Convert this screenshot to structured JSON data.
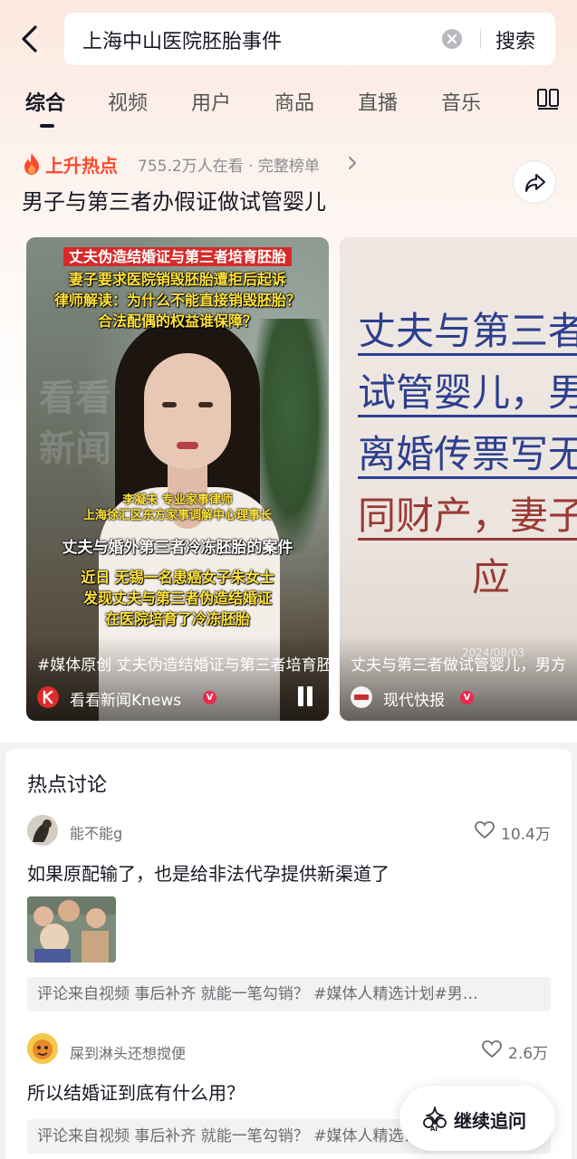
{
  "search": {
    "query": "上海中山医院胚胎事件",
    "button_label": "搜索"
  },
  "tabs": [
    {
      "label": "综合"
    },
    {
      "label": "视频"
    },
    {
      "label": "用户"
    },
    {
      "label": "商品"
    },
    {
      "label": "直播"
    },
    {
      "label": "音乐"
    }
  ],
  "hot": {
    "badge": "上升热点",
    "count_text": "755.2万人在看 · 完整榜单",
    "headline": "男子与第三者办假证做试管婴儿"
  },
  "video_cards": [
    {
      "captions": {
        "red_title": "丈夫伪造结婚证与第三者培育胚胎",
        "line1": "妻子要求医院销毁胚胎遭拒后起诉",
        "line2": "律师解读：为什么不能直接销毁胚胎？",
        "line3": "合法配偶的权益谁保障？",
        "lawyer_name": "李凝未  专业家事律师",
        "lawyer_title": "上海徐汇区东方家事调解中心理事长",
        "case_title": "丈夫与婚外第三者冷冻胚胎的案件",
        "story1": "近日  无锡一名患癌女子朱女士",
        "story2": "发现丈夫与第三者伪造结婚证",
        "story3": "在医院培育了冷冻胚胎"
      },
      "watermark": [
        "看看",
        "新闻"
      ],
      "description": "#媒体原创 丈夫伪造结婚证与第三者培育胚胎",
      "author": "看看新闻Knews",
      "verified_mark": "V"
    },
    {
      "text_lines": [
        "丈夫与第三者",
        "试管婴儿，男",
        "离婚传票写无",
        "同财产，妻子",
        "应"
      ],
      "date": "2024/08/03",
      "description": "丈夫与第三者做试管婴儿，男方",
      "author": "现代快报",
      "verified_mark": "V"
    }
  ],
  "discussion": {
    "title": "热点讨论",
    "comments": [
      {
        "user": "能不能g",
        "likes": "10.4万",
        "text": "如果原配输了，也是给非法代孕提供新渠道了",
        "source": "评论来自视频  事后补齐 就能一笔勾销？ #媒体人精选计划#男…"
      },
      {
        "user": "屎到淋头还想搅便",
        "likes": "2.6万",
        "text": "所以结婚证到底有什么用？",
        "source": "评论来自视频  事后补齐 就能一笔勾销？ #媒体人精选计划#男…"
      }
    ]
  },
  "followup": {
    "label": "继续追问",
    "icon": "ai-sparkle-icon"
  },
  "colors": {
    "hot_accent": "#fe4a2c",
    "verified": "#f2264c",
    "text_primary": "#161823",
    "text_secondary": "#6c6d72"
  }
}
